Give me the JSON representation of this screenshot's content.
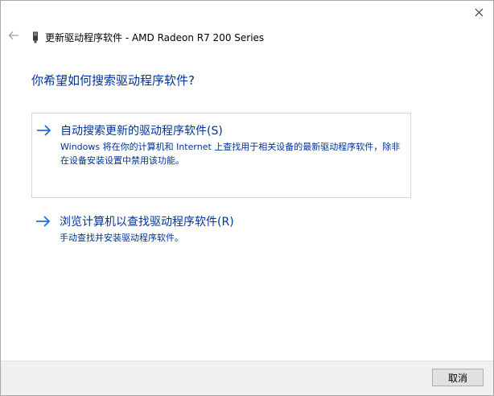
{
  "header": {
    "title": "更新驱动程序软件 - AMD Radeon R7 200 Series",
    "device_icon": "device-driver-icon",
    "back_icon": "back-arrow-icon",
    "close_icon": "close-icon"
  },
  "question": "你希望如何搜索驱动程序软件?",
  "options": [
    {
      "title": "自动搜索更新的驱动程序软件(S)",
      "description": "Windows 将在你的计算机和 Internet 上查找用于相关设备的最新驱动程序软件，除非在设备安装设置中禁用该功能。",
      "selected": true,
      "icon": "arrow-right-icon"
    },
    {
      "title": "浏览计算机以查找驱动程序软件(R)",
      "description": "手动查找并安装驱动程序软件。",
      "selected": false,
      "icon": "arrow-right-icon"
    }
  ],
  "footer": {
    "cancel_label": "取消"
  },
  "colors": {
    "link_blue": "#003399",
    "arrow_blue": "#1e6fd9",
    "footer_bg": "#f0f0f0",
    "selection_border": "#cfd8e3"
  }
}
